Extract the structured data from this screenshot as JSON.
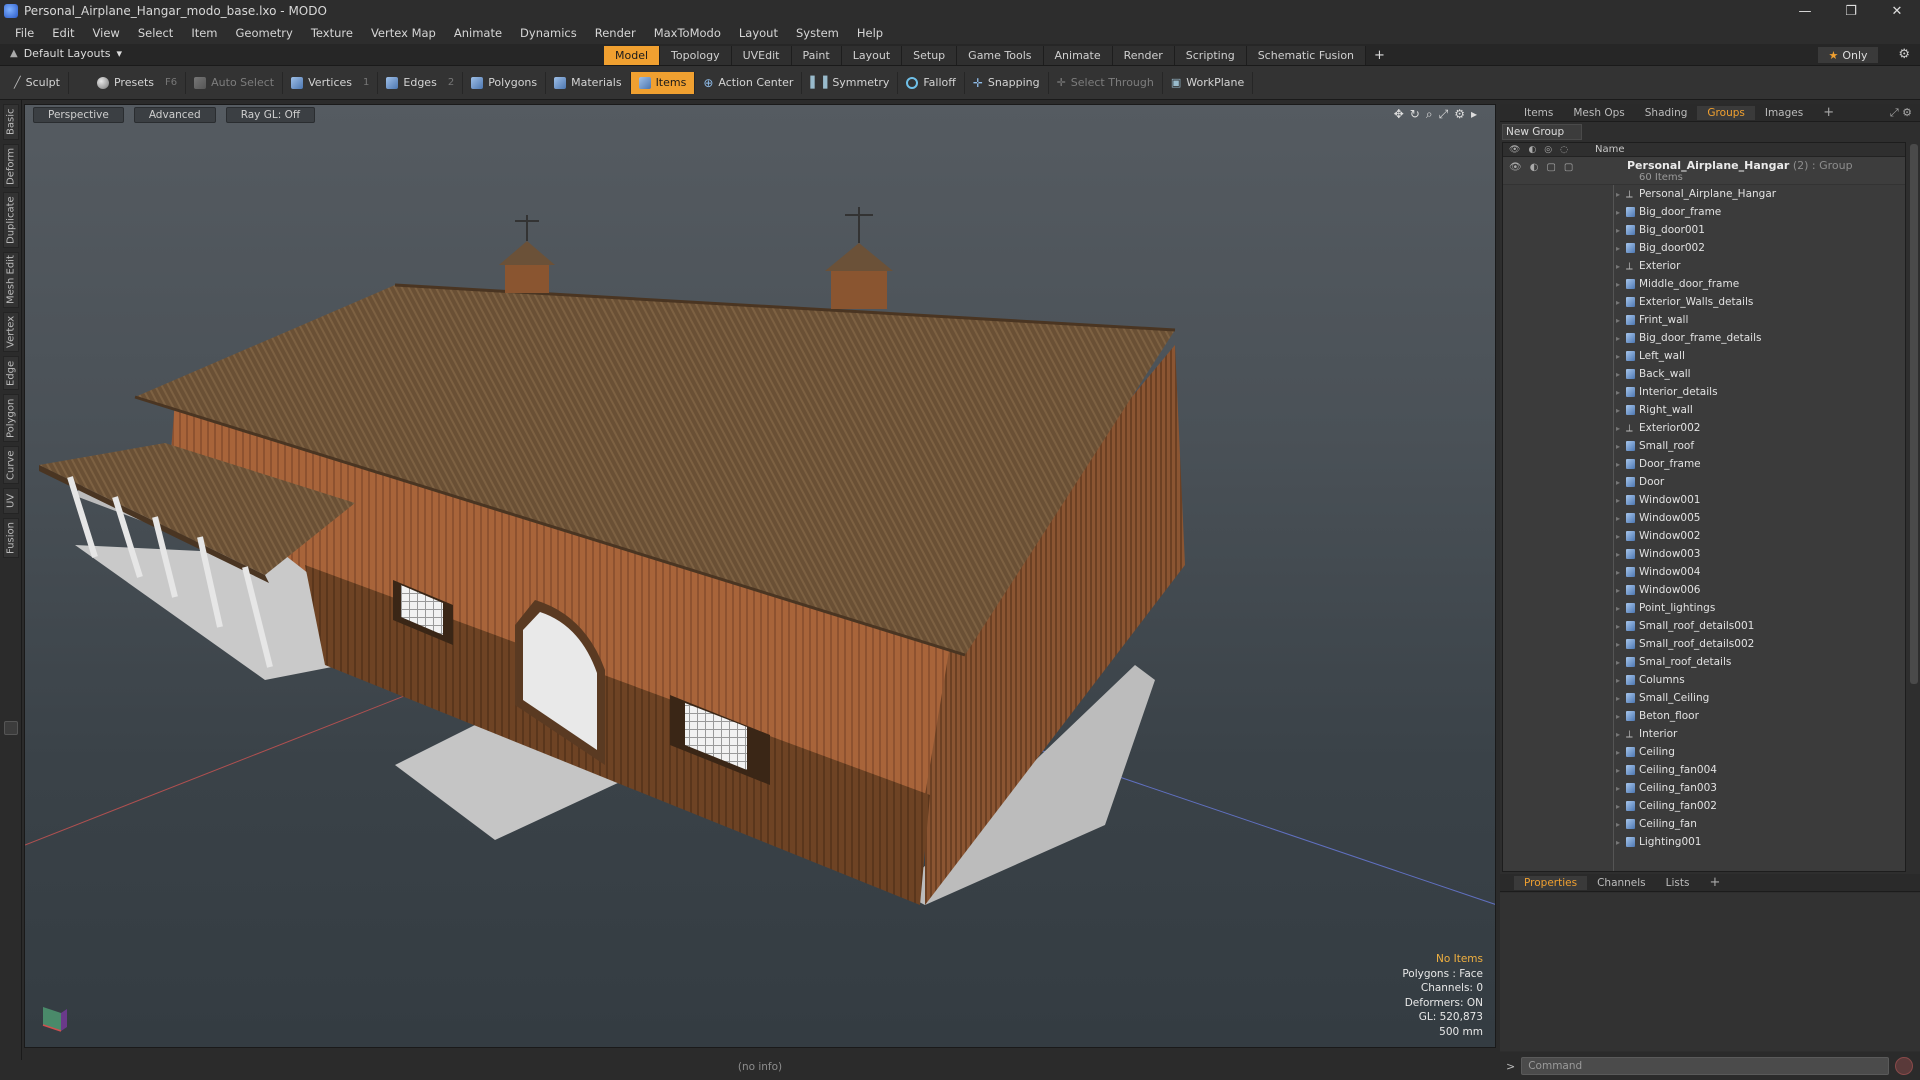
{
  "window": {
    "title": "Personal_Airplane_Hangar_modo_base.lxo - MODO",
    "controls": [
      "—",
      "❐",
      "✕"
    ]
  },
  "menu": [
    "File",
    "Edit",
    "View",
    "Select",
    "Item",
    "Geometry",
    "Texture",
    "Vertex Map",
    "Animate",
    "Dynamics",
    "Render",
    "MaxToModo",
    "Layout",
    "System",
    "Help"
  ],
  "layout": {
    "name": "Default Layouts"
  },
  "tabs": [
    "Model",
    "Topology",
    "UVEdit",
    "Paint",
    "Layout",
    "Setup",
    "Game Tools",
    "Animate",
    "Render",
    "Scripting",
    "Schematic Fusion"
  ],
  "active_tab": "Model",
  "only_label": "Only",
  "toolbar": {
    "sculpt": "Sculpt",
    "presets": "Presets",
    "presets_hotkey": "F6",
    "auto_select": "Auto Select",
    "vertices": "Vertices",
    "vertices_key": "1",
    "edges": "Edges",
    "edges_key": "2",
    "polygons": "Polygons",
    "materials": "Materials",
    "items": "Items",
    "action_center": "Action Center",
    "symmetry": "Symmetry",
    "falloff": "Falloff",
    "snapping": "Snapping",
    "select_through": "Select Through",
    "workplane": "WorkPlane"
  },
  "left_tabs": [
    "Basic",
    "Deform",
    "Duplicate",
    "Mesh Edit",
    "Vertex",
    "Edge",
    "Polygon",
    "Curve",
    "UV",
    "Fusion"
  ],
  "viewport": {
    "view": "Perspective",
    "shading": "Advanced",
    "raygl": "Ray GL: Off",
    "stats": {
      "selection": "No Items",
      "mode": "Polygons : Face",
      "channels": "Channels: 0",
      "deformers": "Deformers: ON",
      "gl": "GL: 520,873",
      "grid": "500 mm"
    }
  },
  "status": "(no info)",
  "panel": {
    "tabs": [
      "Items",
      "Mesh Ops",
      "Shading",
      "Groups",
      "Images"
    ],
    "active_tab": "Groups",
    "new_group": "New Group",
    "col_name": "Name",
    "group": {
      "name": "Personal_Airplane_Hangar",
      "count": " (2) : Group",
      "sub": "60 Items"
    },
    "items": [
      {
        "name": "Personal_Airplane_Hangar",
        "kind": "locator"
      },
      {
        "name": "Big_door_frame",
        "kind": "mesh"
      },
      {
        "name": "Big_door001",
        "kind": "mesh"
      },
      {
        "name": "Big_door002",
        "kind": "mesh"
      },
      {
        "name": "Exterior",
        "kind": "locator"
      },
      {
        "name": "Middle_door_frame",
        "kind": "mesh"
      },
      {
        "name": "Exterior_Walls_details",
        "kind": "mesh"
      },
      {
        "name": "Frint_wall",
        "kind": "mesh"
      },
      {
        "name": "Big_door_frame_details",
        "kind": "mesh"
      },
      {
        "name": "Left_wall",
        "kind": "mesh"
      },
      {
        "name": "Back_wall",
        "kind": "mesh"
      },
      {
        "name": "Interior_details",
        "kind": "mesh"
      },
      {
        "name": "Right_wall",
        "kind": "mesh"
      },
      {
        "name": "Exterior002",
        "kind": "locator"
      },
      {
        "name": "Small_roof",
        "kind": "mesh"
      },
      {
        "name": "Door_frame",
        "kind": "mesh"
      },
      {
        "name": "Door",
        "kind": "mesh"
      },
      {
        "name": "Window001",
        "kind": "mesh"
      },
      {
        "name": "Window005",
        "kind": "mesh"
      },
      {
        "name": "Window002",
        "kind": "mesh"
      },
      {
        "name": "Window003",
        "kind": "mesh"
      },
      {
        "name": "Window004",
        "kind": "mesh"
      },
      {
        "name": "Window006",
        "kind": "mesh"
      },
      {
        "name": "Point_lightings",
        "kind": "mesh"
      },
      {
        "name": "Small_roof_details001",
        "kind": "mesh"
      },
      {
        "name": "Small_roof_details002",
        "kind": "mesh"
      },
      {
        "name": "Smal_roof_details",
        "kind": "mesh"
      },
      {
        "name": "Columns",
        "kind": "mesh"
      },
      {
        "name": "Small_Ceiling",
        "kind": "mesh"
      },
      {
        "name": "Beton_floor",
        "kind": "mesh"
      },
      {
        "name": "Interior",
        "kind": "locator"
      },
      {
        "name": "Ceiling",
        "kind": "mesh"
      },
      {
        "name": "Ceiling_fan004",
        "kind": "mesh"
      },
      {
        "name": "Ceiling_fan003",
        "kind": "mesh"
      },
      {
        "name": "Ceiling_fan002",
        "kind": "mesh"
      },
      {
        "name": "Ceiling_fan",
        "kind": "mesh"
      },
      {
        "name": "Lighting001",
        "kind": "mesh"
      }
    ],
    "lower_tabs": [
      "Properties",
      "Channels",
      "Lists"
    ],
    "lower_active": "Properties",
    "command_placeholder": "Command"
  }
}
